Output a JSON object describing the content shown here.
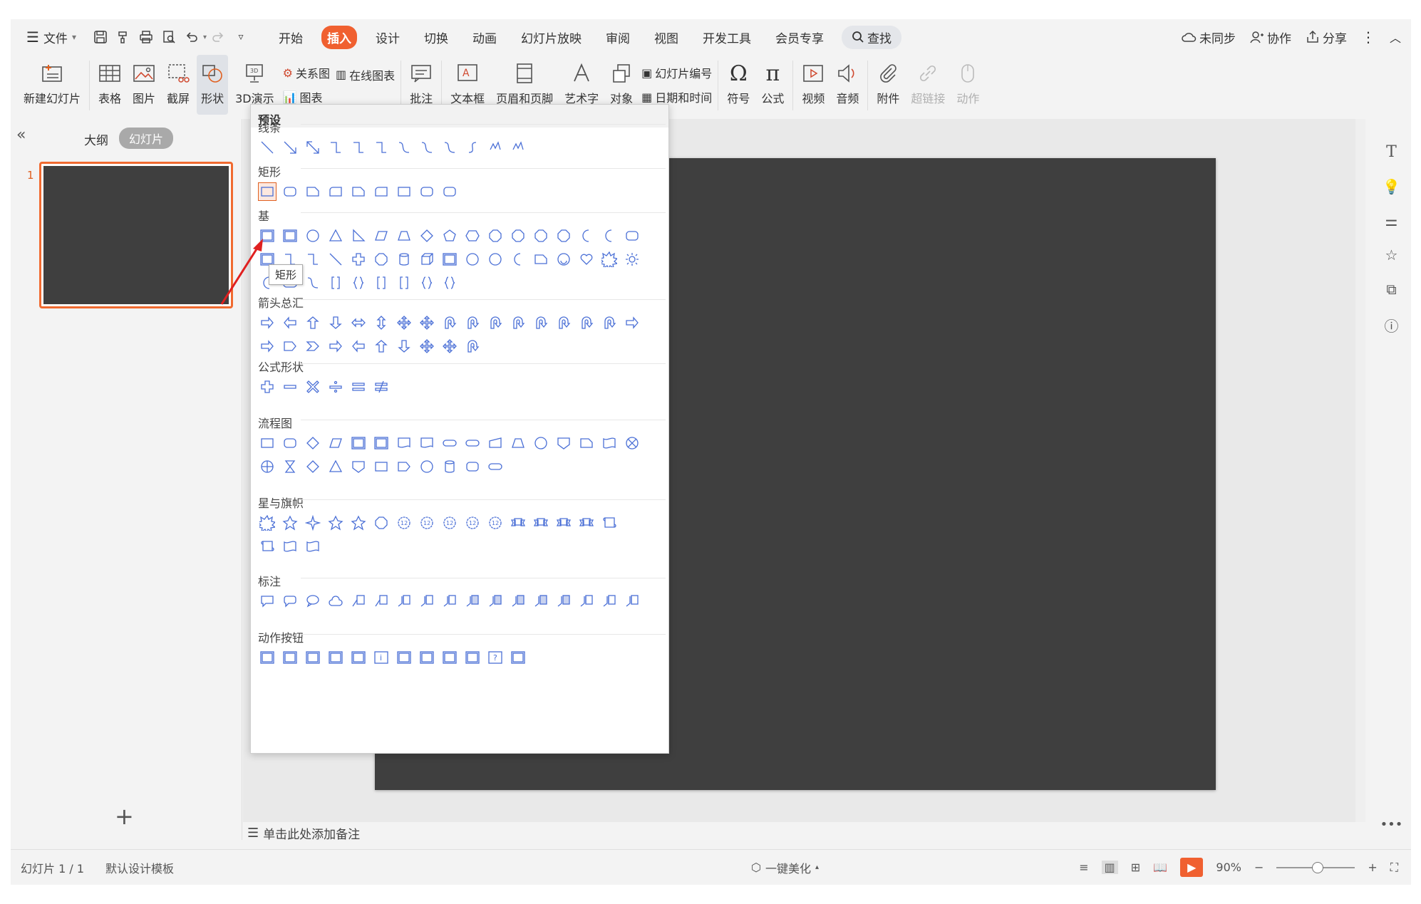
{
  "menubar": {
    "file_label": "文件",
    "tabs": [
      {
        "label": "开始"
      },
      {
        "label": "插入",
        "active": true
      },
      {
        "label": "设计"
      },
      {
        "label": "切换"
      },
      {
        "label": "动画"
      },
      {
        "label": "幻灯片放映"
      },
      {
        "label": "审阅"
      },
      {
        "label": "视图"
      },
      {
        "label": "开发工具"
      },
      {
        "label": "会员专享"
      }
    ],
    "search_label": "查找",
    "sync_label": "未同步",
    "collab_label": "协作",
    "share_label": "分享"
  },
  "ribbon": {
    "new_slide": "新建幻灯片",
    "table": "表格",
    "picture": "图片",
    "screenshot": "截屏",
    "shape": "形状",
    "demo3d": "3D演示",
    "relation": "关系图",
    "online_chart": "在线图表",
    "chart": "图表",
    "comment": "批注",
    "textbox": "文本框",
    "header_footer": "页眉和页脚",
    "wordart": "艺术字",
    "object": "对象",
    "slide_number": "幻灯片编号",
    "datetime": "日期和时间",
    "symbol": "符号",
    "formula": "公式",
    "video": "视频",
    "audio": "音频",
    "attachment": "附件",
    "hyperlink": "超链接",
    "action": "动作"
  },
  "left_panel": {
    "outline_tab": "大纲",
    "slides_tab": "幻灯片",
    "slide_number": "1",
    "add_icon": "+"
  },
  "notes_placeholder": "单击此处添加备注",
  "status": {
    "slide_info": "幻灯片 1 / 1",
    "template": "默认设计模板",
    "beautify": "一键美化",
    "zoom": "90%"
  },
  "dropdown": {
    "header": "预设",
    "sections": {
      "lines": "线条",
      "rect": "矩形",
      "basic": "基",
      "arrows": "箭头总汇",
      "formula": "公式形状",
      "flowchart": "流程图",
      "stars": "星与旗帜",
      "callouts": "标注",
      "action_buttons": "动作按钮"
    },
    "tooltip": "矩形"
  },
  "colors": {
    "accent": "#f06030",
    "slide_bg": "#3f3f3f",
    "shape_stroke": "#4a6fd6"
  }
}
